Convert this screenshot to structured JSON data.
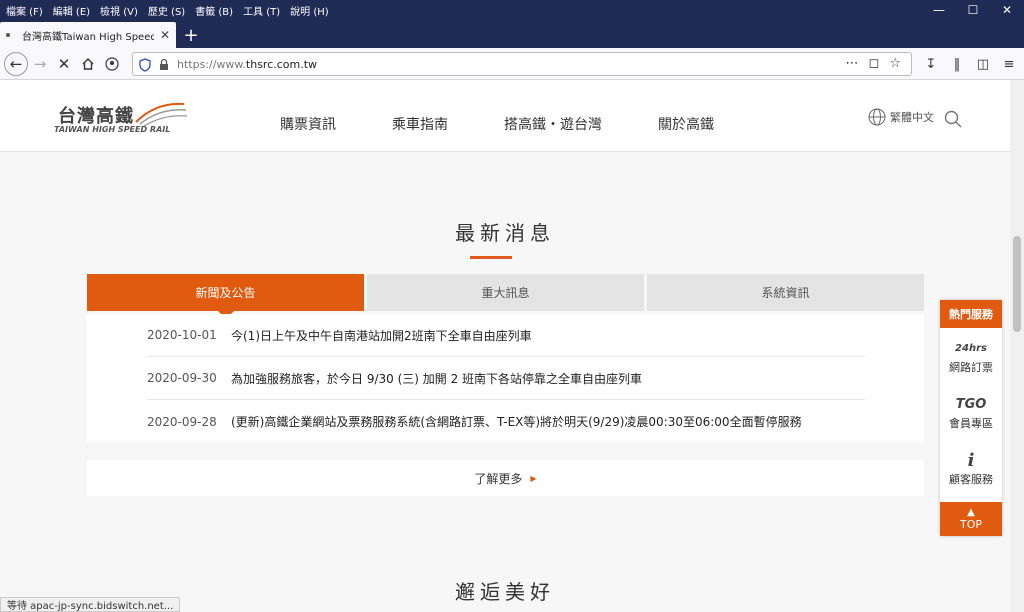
{
  "browser": {
    "menu": [
      "檔案 (F)",
      "編輯 (E)",
      "檢視 (V)",
      "歷史 (S)",
      "書籤 (B)",
      "工具 (T)",
      "說明 (H)"
    ],
    "tab_title": "台灣高鐵Taiwan High Speed R",
    "url_protocol": "https://www.",
    "url_host": "thsrc.com.tw",
    "status": "等待 apac-jp-sync.bidswitch.net..."
  },
  "header": {
    "logo_zh": "台灣高鐵",
    "logo_en": "TAIWAN HIGH SPEED RAIL",
    "nav": [
      "購票資訊",
      "乘車指南",
      "搭高鐵・遊台灣",
      "關於高鐵"
    ],
    "lang": "繁體中文"
  },
  "news": {
    "title": "最新消息",
    "tabs": [
      "新聞及公告",
      "重大訊息",
      "系統資訊"
    ],
    "items": [
      {
        "date": "2020-10-01",
        "text": "今(1)日上午及中午自南港站加開2班南下全車自由座列車"
      },
      {
        "date": "2020-09-30",
        "text": "為加強服務旅客，於今日 9/30 (三) 加開 2 班南下各站停靠之全車自由座列車"
      },
      {
        "date": "2020-09-28",
        "text": "(更新)高鐵企業網站及票務服務系統(含網路訂票、T-EX等)將於明天(9/29)凌晨00:30至06:00全面暫停服務"
      }
    ],
    "more": "了解更多"
  },
  "next_section": {
    "title": "邂逅美好"
  },
  "hot": {
    "title": "熱門服務",
    "items": [
      {
        "icon": "24hrs",
        "label": "網路訂票"
      },
      {
        "icon": "TGO",
        "label": "會員專區"
      },
      {
        "icon": "i",
        "label": "顧客服務"
      }
    ],
    "top": "TOP"
  },
  "colors": {
    "accent": "#e05a10",
    "titlebar": "#1f2a55"
  }
}
